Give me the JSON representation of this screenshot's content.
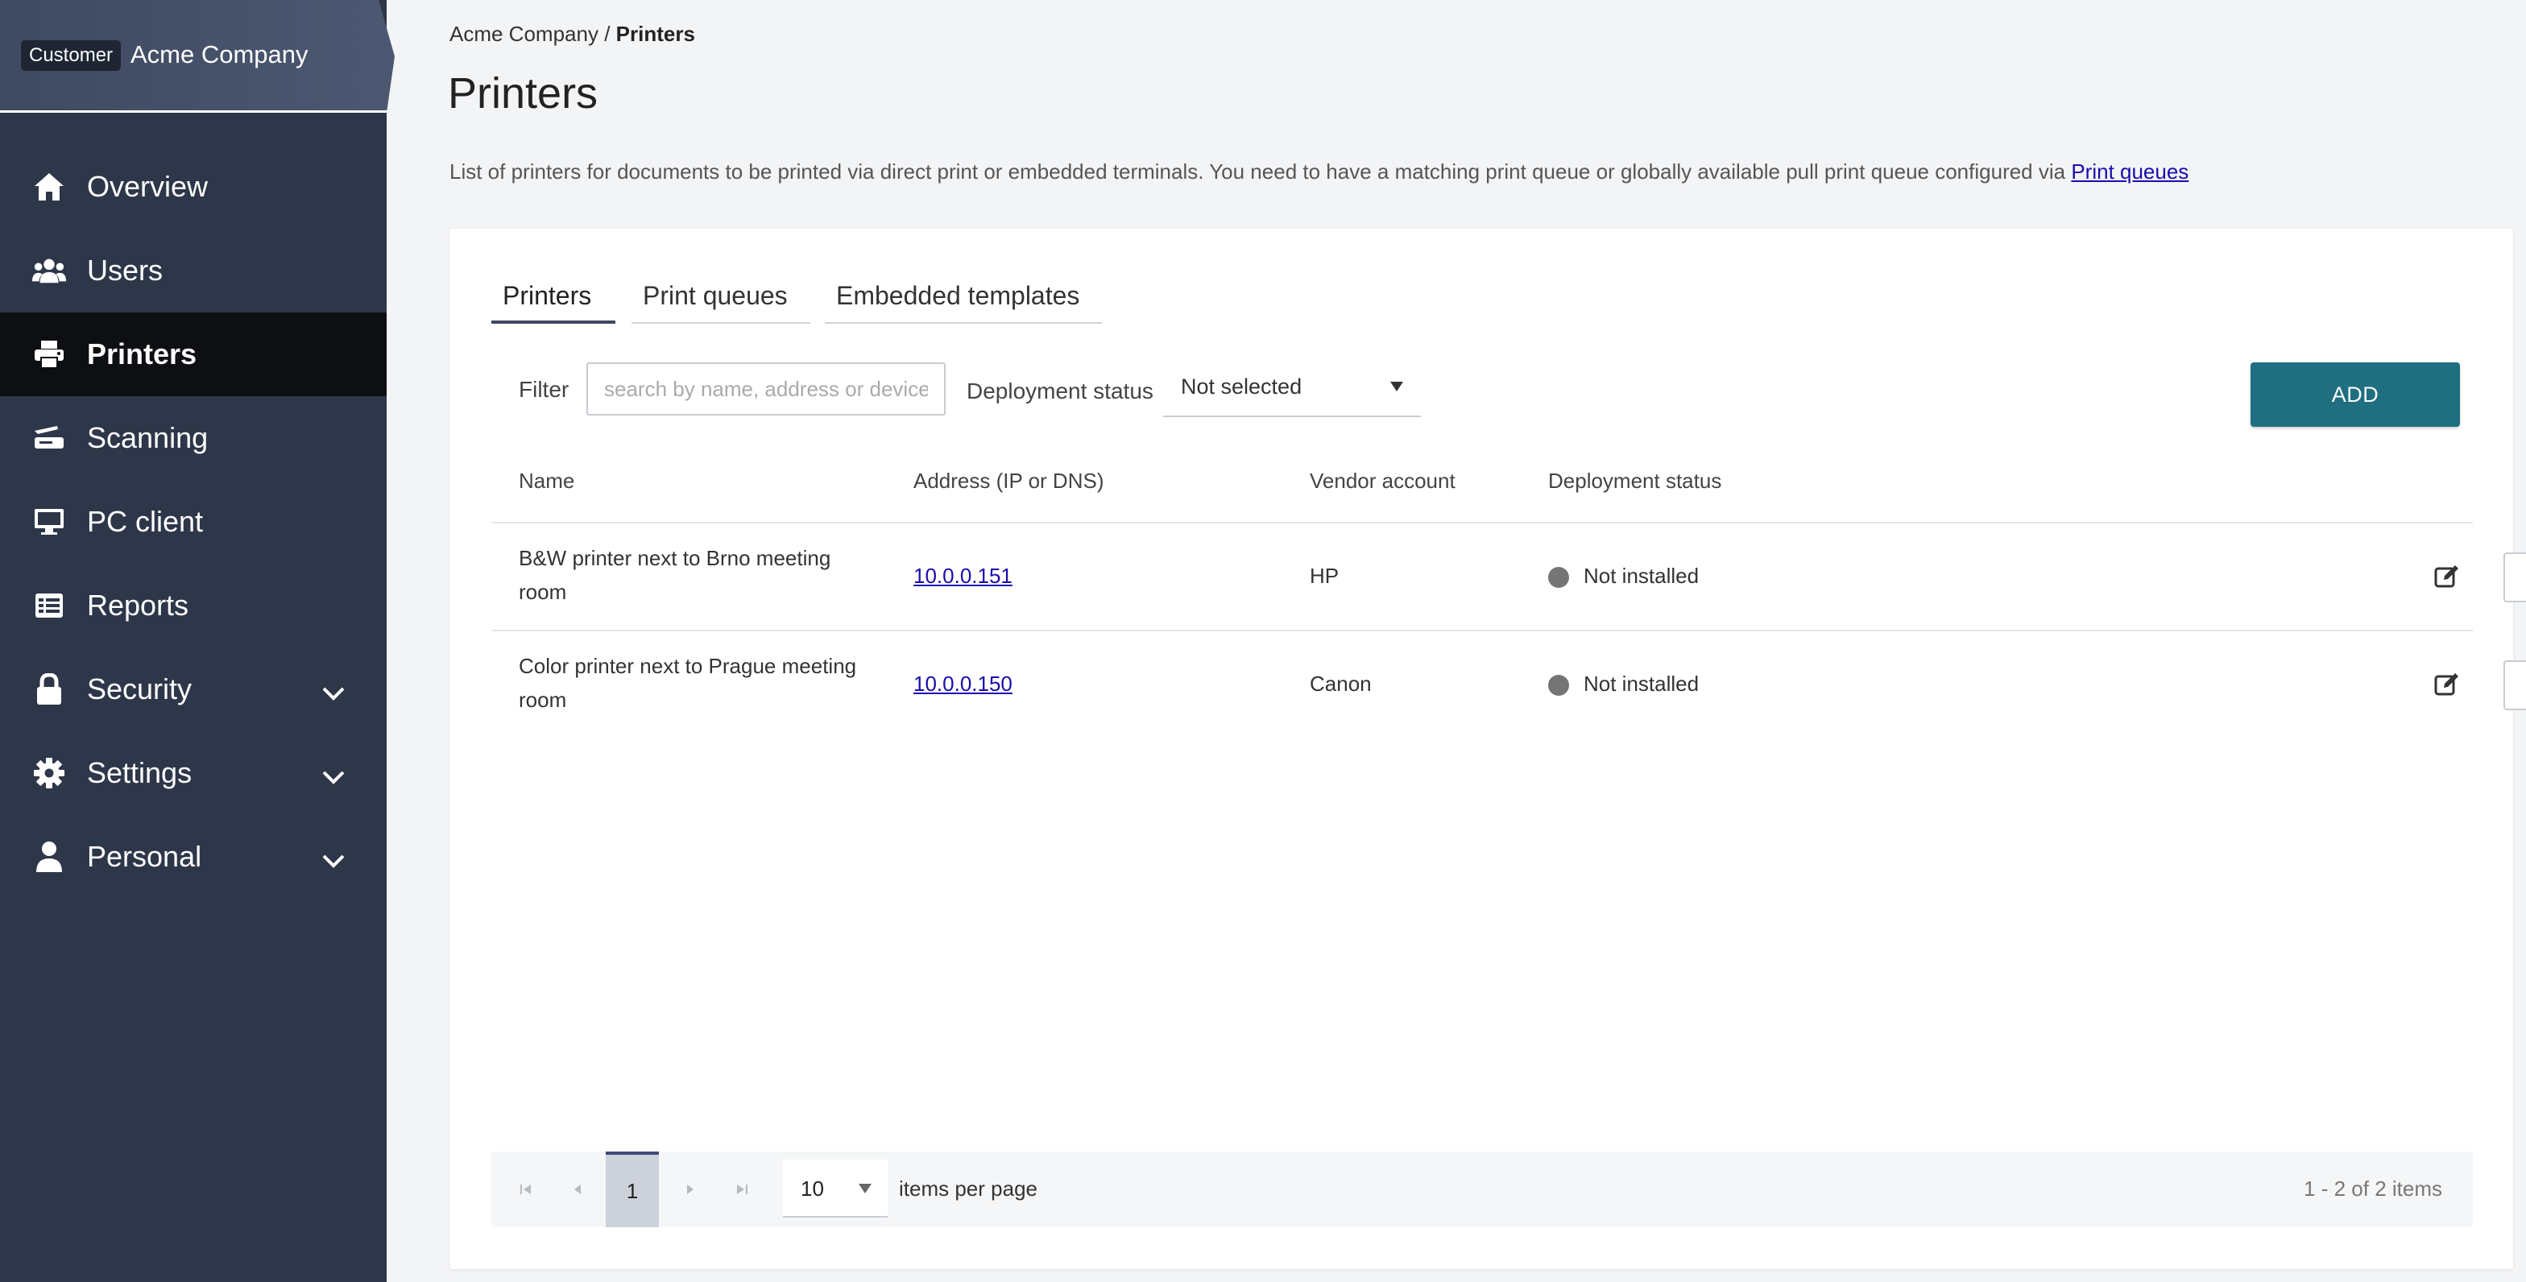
{
  "sidebar": {
    "customer_badge": "Customer",
    "company_name": "Acme Company",
    "items": [
      {
        "label": "Overview",
        "icon": "home-icon"
      },
      {
        "label": "Users",
        "icon": "users-icon"
      },
      {
        "label": "Printers",
        "icon": "printer-icon",
        "active": true
      },
      {
        "label": "Scanning",
        "icon": "scanner-icon"
      },
      {
        "label": "PC client",
        "icon": "monitor-icon"
      },
      {
        "label": "Reports",
        "icon": "reports-icon"
      },
      {
        "label": "Security",
        "icon": "lock-icon",
        "expandable": true
      },
      {
        "label": "Settings",
        "icon": "gear-icon",
        "expandable": true
      },
      {
        "label": "Personal",
        "icon": "person-icon",
        "expandable": true
      }
    ]
  },
  "breadcrumb": {
    "parent": "Acme Company",
    "separator": " / ",
    "current": "Printers"
  },
  "page": {
    "title": "Printers",
    "description": "List of printers for documents to be printed via direct print or embedded terminals. You need to have a matching print queue or globally available pull print queue configured via ",
    "description_link": "Print queues"
  },
  "tabs": [
    {
      "label": "Printers",
      "active": true
    },
    {
      "label": "Print queues"
    },
    {
      "label": "Embedded templates"
    }
  ],
  "filter": {
    "label": "Filter",
    "placeholder": "search by name, address or device",
    "value": "",
    "deployment_label": "Deployment status",
    "deployment_value": "Not selected"
  },
  "add_button": "ADD",
  "table": {
    "columns": [
      "Name",
      "Address (IP or DNS)",
      "Vendor account",
      "Deployment status"
    ],
    "rows": [
      {
        "name_line1": "B&W printer next to Brno meeting",
        "name_line2": "room",
        "address": "10.0.0.151",
        "vendor": "HP",
        "status": "Not installed",
        "more": "..."
      },
      {
        "name_line1": "Color printer next to Prague meeting",
        "name_line2": "room",
        "address": "10.0.0.150",
        "vendor": "Canon",
        "status": "Not installed",
        "more": "..."
      }
    ]
  },
  "pager": {
    "current_page": "1",
    "page_size": "10",
    "items_per_page_label": "items per page",
    "summary": "1 - 2 of 2 items"
  },
  "colors": {
    "sidebar_bg": "#2e3749",
    "active_nav_bg": "#0d0f13",
    "accent": "#1f6f80",
    "status_not_installed": "#757575",
    "link": "#1a0dab"
  }
}
